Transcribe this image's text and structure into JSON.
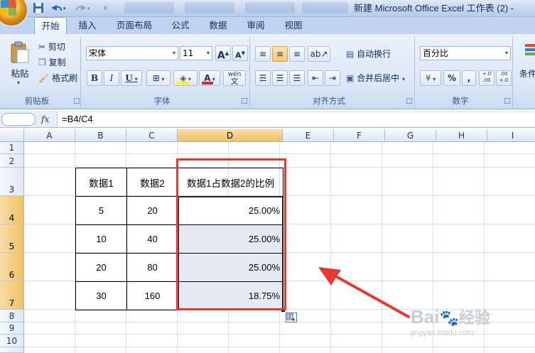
{
  "window": {
    "title": "新建 Microsoft Office Excel 工作表 (2) -"
  },
  "tabs": [
    {
      "label": "开始",
      "active": true
    },
    {
      "label": "插入"
    },
    {
      "label": "页面布局"
    },
    {
      "label": "公式"
    },
    {
      "label": "数据"
    },
    {
      "label": "审阅"
    },
    {
      "label": "视图"
    }
  ],
  "ribbon": {
    "clipboard": {
      "paste": "粘贴",
      "cut": "剪切",
      "copy": "复制",
      "format_painter": "格式刷",
      "group_label": "剪贴板"
    },
    "font": {
      "font_name": "宋体",
      "font_size": "11",
      "grow": "A",
      "shrink": "A",
      "bold": "B",
      "italic": "I",
      "underline": "U",
      "font_color_glyph": "A",
      "phonetic_glyph": "wén",
      "phonetic_glyph2": "文",
      "group_label": "字体"
    },
    "alignment": {
      "wrap_text": "自动换行",
      "merge_center": "合并后居中",
      "group_label": "对齐方式"
    },
    "number": {
      "format": "百分比",
      "percent": "%",
      "comma": ",",
      "inc_dec": "+.0 .00",
      "dec_dec": ".00 +.0",
      "currency": "¥",
      "group_label": "数字"
    },
    "styles": {
      "conditional": "条件"
    }
  },
  "formula_bar": {
    "fx": "fx",
    "formula": "=B4/C4"
  },
  "columns": [
    "A",
    "B",
    "C",
    "D",
    "E",
    "F",
    "G",
    "H",
    "I"
  ],
  "rows": [
    "1",
    "2",
    "3",
    "4",
    "5",
    "6",
    "7",
    "8",
    "9",
    "10"
  ],
  "table": {
    "headers": [
      "数据1",
      "数据2",
      "数据1占数据2的比例"
    ],
    "rows": [
      [
        "5",
        "20",
        "25.00%"
      ],
      [
        "10",
        "40",
        "25.00%"
      ],
      [
        "20",
        "80",
        "25.00%"
      ],
      [
        "30",
        "160",
        "18.75%"
      ]
    ]
  },
  "watermark": {
    "brand": "Bai",
    "brand2": "经验",
    "url": "jingyan.baidu.com"
  },
  "colors": {
    "highlight_box": "#e03a33",
    "selection_fill": "#e6e9f4",
    "selected_header": "#f1c15e"
  }
}
